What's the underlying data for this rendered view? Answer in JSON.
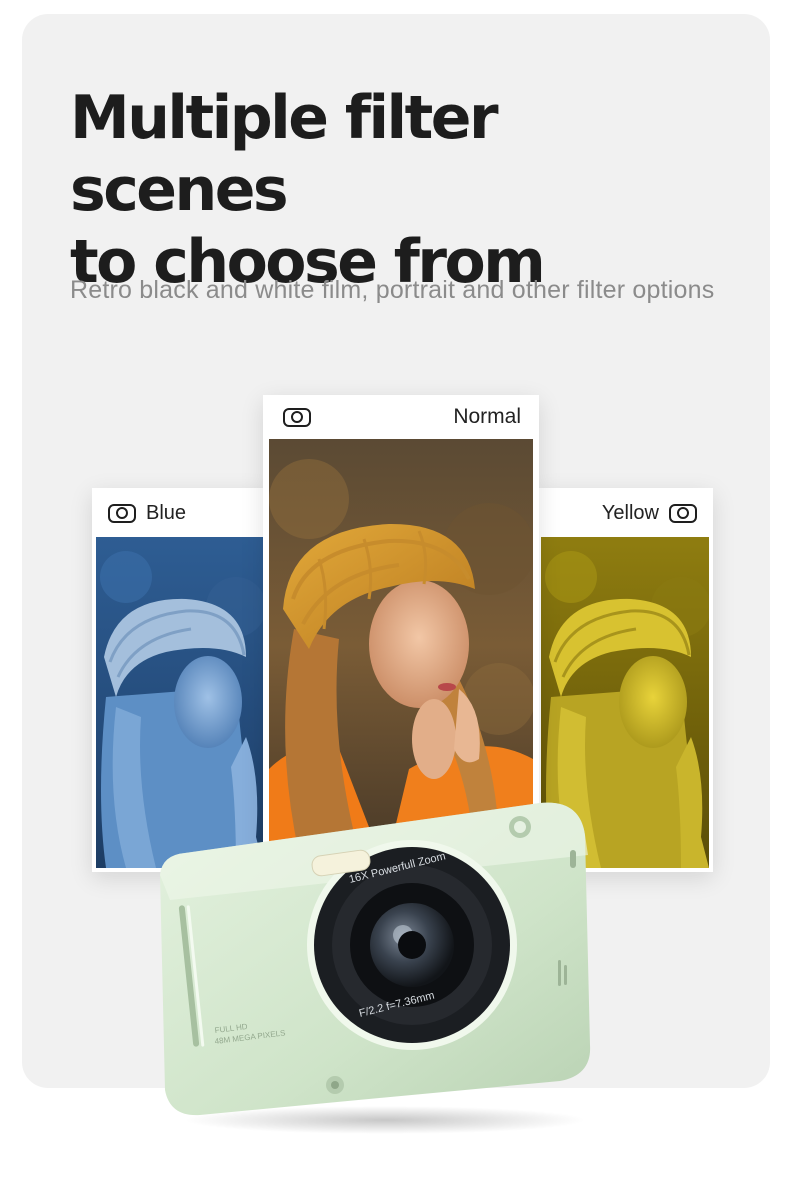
{
  "headline": {
    "line1": "Multiple filter scenes",
    "line2": "to choose from"
  },
  "subtitle": "Retro black and white film, portrait and other filter options",
  "filters": {
    "blue": {
      "label": "Blue",
      "icon": "camera-mode-icon",
      "tint": "#3d6fa8"
    },
    "normal": {
      "label": "Normal",
      "icon": "camera-mode-icon"
    },
    "yellow": {
      "label": "Yellow",
      "icon": "camera-mode-icon",
      "tint": "#b7a51d"
    }
  },
  "camera": {
    "lens_top_text": "16X Powerfull Zoom",
    "lens_bottom_text": "F/2.2  f=7.36mm",
    "body_text_line1": "FULL HD",
    "body_text_line2": "48M MEGA PIXELS",
    "body_color": "#d7ead2"
  }
}
